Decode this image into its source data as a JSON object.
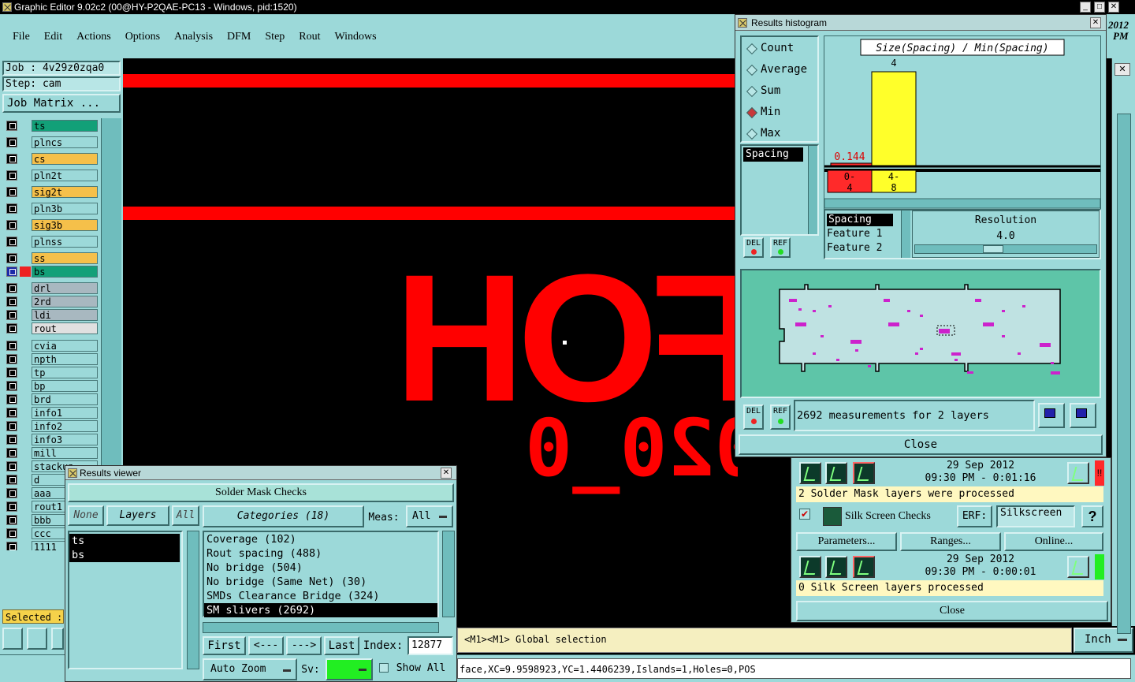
{
  "window": {
    "title": "Graphic Editor 9.02c2 (00@HY-P2QAE-PC13 - Windows, pid:1520)"
  },
  "menu": [
    "File",
    "Edit",
    "Actions",
    "Options",
    "Analysis",
    "DFM",
    "Step",
    "Rout",
    "Windows"
  ],
  "job": {
    "job_label": "Job : 4v29z0zqa0",
    "step_label": "Step: cam",
    "matrix_button": "Job Matrix ..."
  },
  "layers": [
    {
      "name": "ts",
      "color": "#12a078"
    },
    {
      "name": "plncs",
      "color": "#9cd9d9"
    },
    {
      "name": "cs",
      "color": "#f5c04a"
    },
    {
      "name": "pln2t",
      "color": "#9cd9d9"
    },
    {
      "name": "sig2t",
      "color": "#f5c04a"
    },
    {
      "name": "pln3b",
      "color": "#9cd9d9"
    },
    {
      "name": "sig3b",
      "color": "#f5c04a"
    },
    {
      "name": "plnss",
      "color": "#9cd9d9"
    },
    {
      "name": "ss",
      "color": "#f5c04a"
    },
    {
      "name": "bs",
      "color": "#12a078"
    },
    {
      "name": "drl",
      "color": "#a8b8c0"
    },
    {
      "name": "2rd",
      "color": "#a8b8c0"
    },
    {
      "name": "ldi",
      "color": "#a8b8c0"
    },
    {
      "name": "rout",
      "color": "#e0e0e0"
    },
    {
      "name": "cvia",
      "color": "#9cd9d9"
    },
    {
      "name": "npth",
      "color": "#9cd9d9"
    },
    {
      "name": "tp",
      "color": "#9cd9d9"
    },
    {
      "name": "bp",
      "color": "#9cd9d9"
    },
    {
      "name": "brd",
      "color": "#9cd9d9"
    },
    {
      "name": "info1",
      "color": "#9cd9d9"
    },
    {
      "name": "info2",
      "color": "#9cd9d9"
    },
    {
      "name": "info3",
      "color": "#9cd9d9"
    },
    {
      "name": "mill",
      "color": "#9cd9d9"
    },
    {
      "name": "stackup",
      "color": "#9cd9d9"
    },
    {
      "name": "d",
      "color": "#9cd9d9"
    },
    {
      "name": "aaa",
      "color": "#9cd9d9"
    },
    {
      "name": "rout1",
      "color": "#9cd9d9"
    },
    {
      "name": "bbb",
      "color": "#9cd9d9"
    },
    {
      "name": "ccc",
      "color": "#9cd9d9"
    },
    {
      "name": "1111",
      "color": "#9cd9d9"
    }
  ],
  "selected_label": "Selected :",
  "canvas": {
    "text_big": "FFOH",
    "text_small": "0_020_0"
  },
  "status": {
    "mouse": "<M1><M1> Global selection",
    "unit": "Inch",
    "info": "face,XC=9.9598923,YC=1.4406239,Islands=1,Holes=0,POS"
  },
  "results_viewer": {
    "title": "Results viewer",
    "header": "Solder Mask Checks",
    "none_btn": "None",
    "layers_btn": "Layers",
    "all_btn": "All",
    "categories_btn": "Categories (18)",
    "meas_label": "Meas:",
    "meas_value": "All",
    "layers": [
      "ts",
      "bs"
    ],
    "categories": [
      "Coverage (102)",
      "Rout spacing (488)",
      "No bridge (504)",
      "No bridge (Same Net) (30)",
      "SMDs Clearance Bridge (324)",
      "SM slivers (2692)"
    ],
    "first_btn": "First",
    "prev_btn": "<---",
    "next_btn": "--->",
    "last_btn": "Last",
    "index_label": "Index:",
    "index_value": "12877",
    "zoom_btn": "Auto Zoom",
    "sv_label": "Sv:",
    "show_all": "Show All"
  },
  "histogram": {
    "title": "Results histogram",
    "options": [
      "Count",
      "Average",
      "Sum",
      "Min",
      "Max"
    ],
    "selected_option": "Min",
    "chart_title": "Size(Spacing) / Min(Spacing)",
    "bar_value": "4",
    "min_value": "0.144",
    "bins": [
      {
        "label": "0-4",
        "color": "#ff2a2a"
      },
      {
        "label": "4-8",
        "color": "#ffff2a"
      }
    ],
    "list_item": "Spacing",
    "del_label": "DEL",
    "ref_label": "REF",
    "attr_items": [
      "Spacing",
      "Feature 1",
      "Feature 2"
    ],
    "resolution_label": "Resolution",
    "resolution_value": "4.0",
    "measurements": "2692 measurements for 2 layers",
    "close": "Close"
  },
  "checks": {
    "date1": "29 Sep 2012",
    "time1": "09:30 PM - 0:01:16",
    "msg1": "2 Solder Mask layers were processed",
    "silk_label": "Silk Screen Checks",
    "erf_label": "ERF:",
    "erf_value": "Silkscreen",
    "help": "?",
    "params_btn": "Parameters...",
    "ranges_btn": "Ranges...",
    "online_btn": "Online...",
    "date2": "29 Sep 2012",
    "time2": "09:30 PM - 0:00:01",
    "msg2": "0 Silk Screen layers processed",
    "close": "Close",
    "corner_top": "2012",
    "corner_bottom": "PM"
  }
}
